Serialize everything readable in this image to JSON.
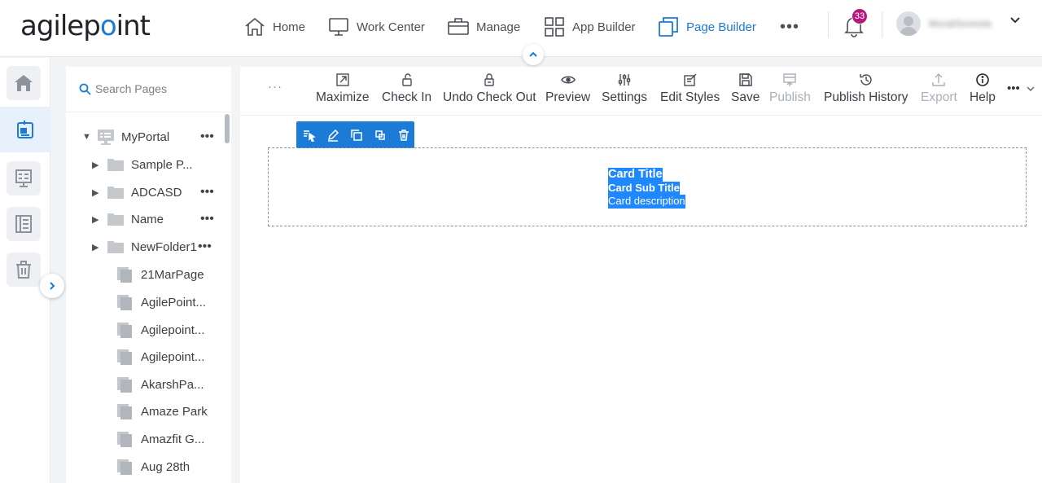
{
  "brand": {
    "logo_text_a": "agilep",
    "logo_text_b": "o",
    "logo_text_c": "int"
  },
  "nav": [
    {
      "label": "Home",
      "icon": "home-icon"
    },
    {
      "label": "Work Center",
      "icon": "monitor-icon"
    },
    {
      "label": "Manage",
      "icon": "briefcase-icon"
    },
    {
      "label": "App Builder",
      "icon": "grid-icon"
    },
    {
      "label": "Page Builder",
      "icon": "pages-icon",
      "active": true
    }
  ],
  "nav_more": "•••",
  "notifications": {
    "count": "33"
  },
  "user": {
    "name": "MuraliSonesta"
  },
  "tree": {
    "search_placeholder": "Search Pages",
    "root": {
      "label": "MyPortal",
      "menu": "•••"
    },
    "folders": [
      {
        "label": "Sample P...",
        "menu": ""
      },
      {
        "label": "ADCASD",
        "menu": "•••"
      },
      {
        "label": "Name",
        "menu": "•••"
      },
      {
        "label": "NewFolder1",
        "menu": "•••"
      }
    ],
    "pages": [
      "21MarPage",
      "AgilePoint...",
      "Agilepoint...",
      "Agilepoint...",
      "AkarshPa...",
      "Amaze Park",
      "Amazfit G...",
      "Aug 28th"
    ]
  },
  "toolbar": {
    "left_more": "···",
    "buttons": [
      {
        "label": "Maximize",
        "icon": "maximize-icon",
        "enabled": true
      },
      {
        "label": "Check In",
        "icon": "unlock-icon",
        "enabled": true
      },
      {
        "label": "Undo Check Out",
        "icon": "undo-lock-icon",
        "enabled": true
      },
      {
        "label": "Preview",
        "icon": "eye-icon",
        "enabled": true
      },
      {
        "label": "Settings",
        "icon": "sliders-icon",
        "enabled": true
      },
      {
        "label": "Edit Styles",
        "icon": "edit-styles-icon",
        "enabled": true
      },
      {
        "label": "Save",
        "icon": "save-icon",
        "enabled": true
      },
      {
        "label": "Publish",
        "icon": "publish-icon",
        "enabled": false
      },
      {
        "label": "Publish History",
        "icon": "history-icon",
        "enabled": true
      },
      {
        "label": "Export",
        "icon": "export-icon",
        "enabled": false
      },
      {
        "label": "Help",
        "icon": "info-icon",
        "enabled": true
      }
    ],
    "more": "•••"
  },
  "card": {
    "title": "Card Title",
    "subtitle": "Card Sub Title",
    "description": "Card description"
  },
  "colors": {
    "accent": "#1b7bd6",
    "badge": "#b5177c",
    "selection": "#1f87ff"
  }
}
